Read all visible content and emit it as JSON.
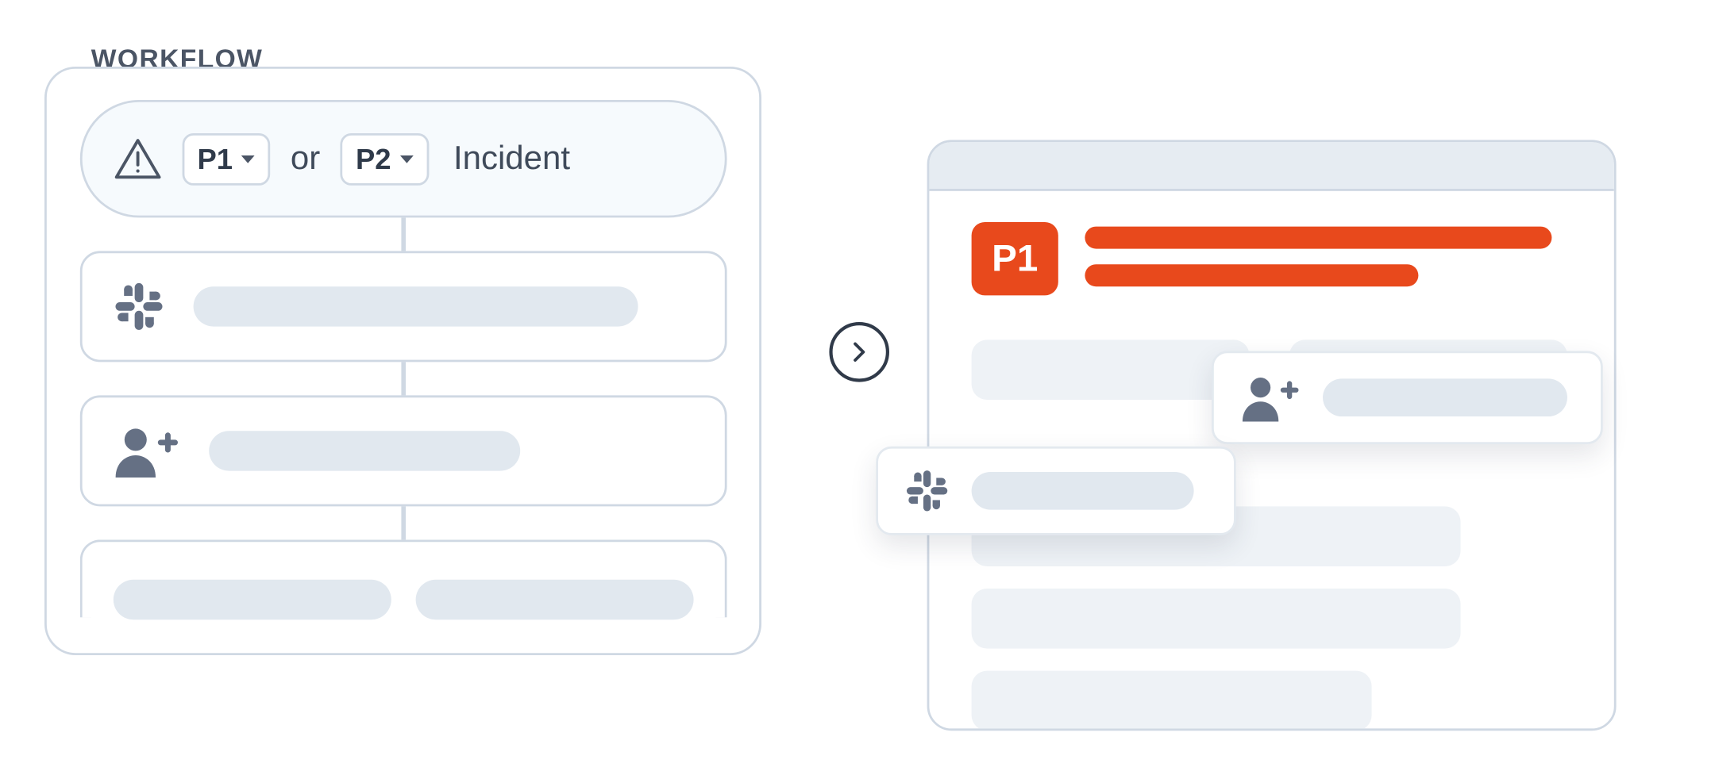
{
  "workflow": {
    "label": "WORKFLOW",
    "trigger": {
      "priority1": "P1",
      "priority2": "P2",
      "conjunction": "or",
      "noun": "Incident"
    }
  },
  "output": {
    "priority_badge": "P1"
  },
  "icons": {
    "warning": "warning-triangle",
    "slack": "slack",
    "person_add": "add-person",
    "chevron_right": "chevron-right"
  },
  "colors": {
    "accent": "#E8491C",
    "line": "#CFD8E3",
    "muted_fill": "#E1E8EF",
    "text": "#3F4A5A"
  }
}
